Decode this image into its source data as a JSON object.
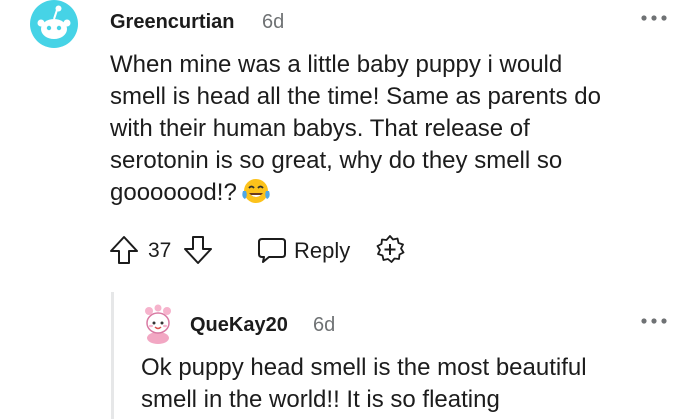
{
  "comment": {
    "author": "Greencurtian",
    "time": "6d",
    "lines": [
      "When mine was a little baby puppy i would",
      "smell is head all the time! Same as parents do",
      "with their human babys. That release of",
      "serotonin is so great, why do they smell so",
      "gooooood!?"
    ],
    "emoji": "face-with-tears-of-joy-icon",
    "score": "37",
    "reply_label": "Reply"
  },
  "reply": {
    "author": "QueKay20",
    "time": "6d",
    "lines": [
      "Ok puppy head smell is the most beautiful",
      "smell in the world!! It is so fleating"
    ]
  },
  "colors": {
    "text": "#1c1c1c",
    "meta": "#6f7274",
    "avatar_bg": "#46d3e6",
    "thread_line": "#e6e7e8"
  }
}
